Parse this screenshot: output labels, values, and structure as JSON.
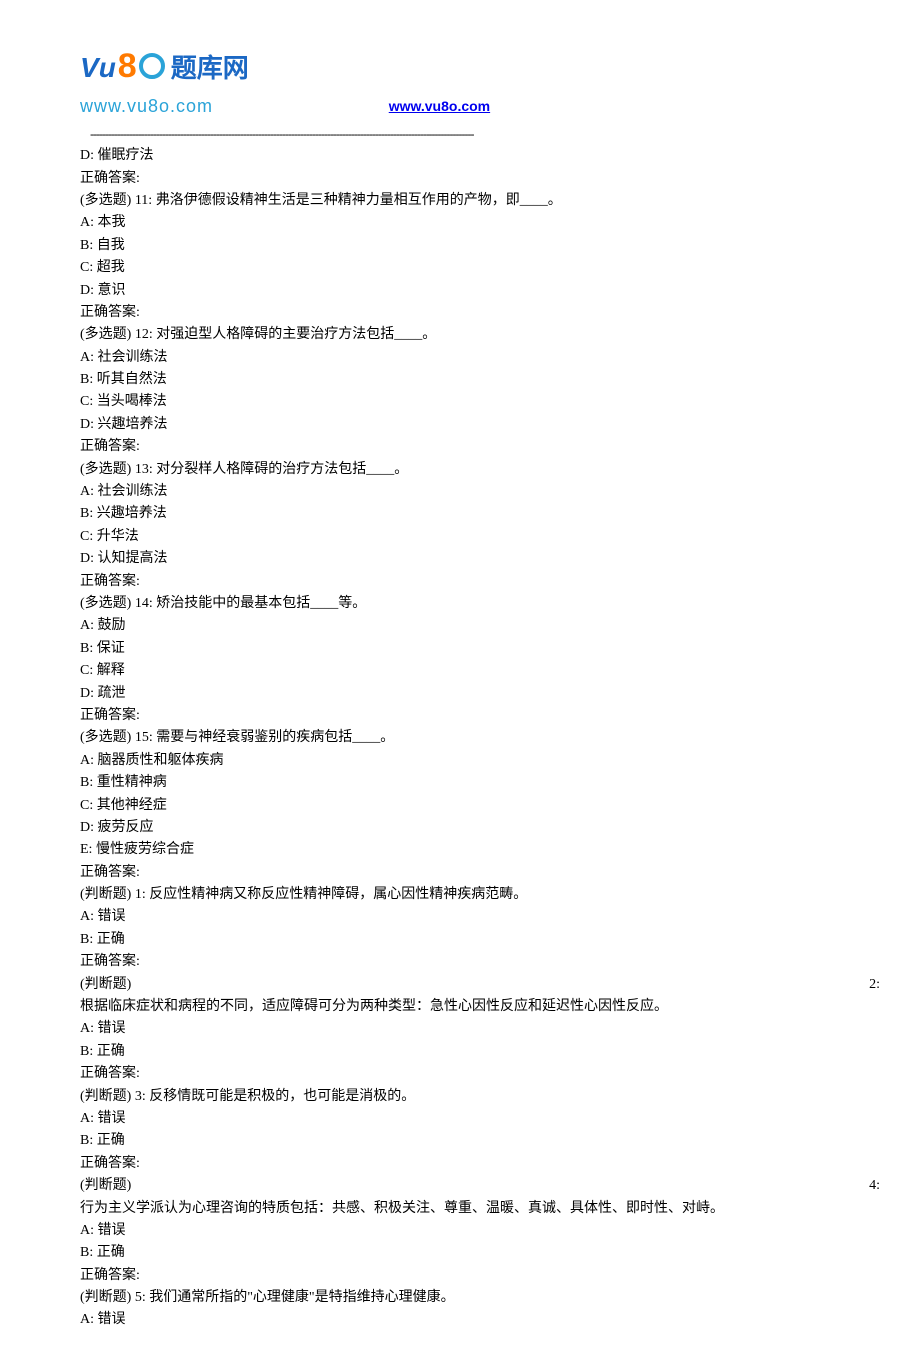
{
  "header": {
    "logo_cn": "题库网",
    "logo_url": "www.vu8o.com",
    "link_text": "www.vu8o.com",
    "link_href": "http://www.vu8o.com"
  },
  "lines": [
    "D: 催眠疗法",
    "正确答案:",
    "(多选题) 11: 弗洛伊德假设精神生活是三种精神力量相互作用的产物，即____。",
    "A: 本我",
    "B: 自我",
    "C: 超我",
    "D: 意识",
    "正确答案:",
    "(多选题) 12: 对强迫型人格障碍的主要治疗方法包括____。",
    "A: 社会训练法",
    "B: 听其自然法",
    "C: 当头喝棒法",
    "D: 兴趣培养法",
    "正确答案:",
    "(多选题) 13: 对分裂样人格障碍的治疗方法包括____。",
    "A: 社会训练法",
    "B: 兴趣培养法",
    "C: 升华法",
    "D: 认知提高法",
    "正确答案:",
    "(多选题) 14: 矫治技能中的最基本包括____等。",
    "A: 鼓励",
    "B: 保证",
    "C: 解释",
    "D: 疏泄",
    "正确答案:",
    "(多选题) 15: 需要与神经衰弱鉴别的疾病包括____。",
    "A: 脑器质性和躯体疾病",
    "B: 重性精神病",
    "C: 其他神经症",
    "D: 疲劳反应",
    "E: 慢性疲劳综合症",
    "正确答案:",
    "(判断题) 1: 反应性精神病又称反应性精神障碍，属心因性精神疾病范畴。",
    "A: 错误",
    "B: 正确",
    "正确答案:"
  ],
  "split_q2": {
    "left": "(判断题)",
    "right": "2:",
    "text": "根据临床症状和病程的不同，适应障碍可分为两种类型：急性心因性反应和延迟性心因性反应。"
  },
  "lines2": [
    "A: 错误",
    "B: 正确",
    "正确答案:",
    "(判断题) 3: 反移情既可能是积极的，也可能是消极的。",
    "A: 错误",
    "B: 正确",
    "正确答案:"
  ],
  "split_q4": {
    "left": "(判断题)",
    "right": "4:",
    "text": "行为主义学派认为心理咨询的特质包括：共感、积极关注、尊重、温暖、真诚、具体性、即时性、对峙。"
  },
  "lines3": [
    "A: 错误",
    "B: 正确",
    "正确答案:",
    "(判断题) 5: 我们通常所指的\"心理健康\"是特指维持心理健康。",
    "A: 错误"
  ]
}
